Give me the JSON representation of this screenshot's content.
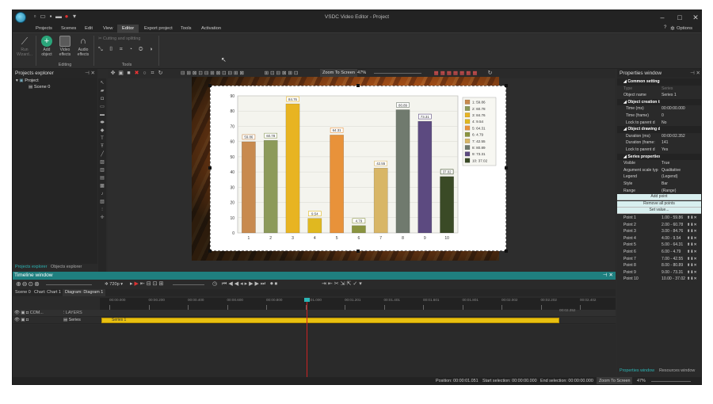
{
  "app": {
    "title": "VSDC Video Editor - Project",
    "options": "Options"
  },
  "menu": [
    "Projects",
    "Scenes",
    "Edit",
    "View",
    "Editor",
    "Export project",
    "Tools",
    "Activation"
  ],
  "ribbon": {
    "run_wizard": "Run Wizard...",
    "add_object": "Add object",
    "video_effects": "Video effects",
    "audio_effects": "Audio effects",
    "editing_group": "Editing",
    "cutting": "Cutting and splitting",
    "tools_group": "Tools"
  },
  "projects_explorer": {
    "title": "Projects explorer",
    "project": "Project",
    "scene": "Scene 0",
    "tab_projects": "Projects explorer",
    "tab_objects": "Objects explorer"
  },
  "editor_toolbar": {
    "zoom_label": "Zoom To Screen",
    "zoom_value": "47%"
  },
  "chart_data": {
    "type": "bar",
    "categories": [
      "1",
      "2",
      "3",
      "4",
      "5",
      "6",
      "7",
      "8",
      "9",
      "10"
    ],
    "values": [
      59.86,
      60.78,
      84.76,
      9.54,
      64.31,
      4.79,
      42.55,
      80.89,
      73.31,
      37.02
    ],
    "data_labels": [
      "59.86",
      "60.78",
      "84.76",
      "9.54",
      "64.31",
      "4.79",
      "42.55",
      "80.89",
      "73.31",
      "37.02"
    ],
    "legend": [
      "1: 59.86",
      "2: 60.78",
      "3: 84.76",
      "4: 9.54",
      "5: 64.31",
      "6: 4.79",
      "7: 42.55",
      "8: 80.89",
      "9: 73.31",
      "10: 37.02"
    ],
    "colors": [
      "#c88a4e",
      "#8c9a5a",
      "#e8b422",
      "#e0b820",
      "#e8923a",
      "#8a9440",
      "#d8b666",
      "#707a6e",
      "#5c4a80",
      "#3a4a26"
    ],
    "ylim": [
      0,
      90
    ],
    "yticks": [
      "0",
      "10",
      "20",
      "30",
      "40",
      "50",
      "60",
      "70",
      "80",
      "90"
    ],
    "grid": true,
    "legend_position": "right",
    "title": "",
    "xlabel": "",
    "ylabel": ""
  },
  "properties": {
    "title": "Properties window",
    "rows": [
      {
        "k": "Common settings",
        "v": "",
        "type": "sec"
      },
      {
        "k": "Type",
        "v": "Series",
        "type": "dim"
      },
      {
        "k": "Object name",
        "v": "Series 1",
        "type": "row"
      },
      {
        "k": "Object creation time",
        "v": "",
        "type": "sec"
      },
      {
        "k": "Time (ms)",
        "v": "00:00:00.000",
        "type": "sub"
      },
      {
        "k": "Time (frame)",
        "v": "0",
        "type": "sub"
      },
      {
        "k": "Lock to parent d",
        "v": "No",
        "type": "sub"
      },
      {
        "k": "Object drawing duration",
        "v": "",
        "type": "sec"
      },
      {
        "k": "Duration (ms)",
        "v": "00:00:02.352",
        "type": "sub"
      },
      {
        "k": "Duration (frame:",
        "v": "141",
        "type": "sub"
      },
      {
        "k": "Lock to parent d",
        "v": "Yes",
        "type": "sub"
      },
      {
        "k": "Series properties",
        "v": "",
        "type": "sec"
      },
      {
        "k": "Visible",
        "v": "True",
        "type": "row"
      },
      {
        "k": "Argument scale typ",
        "v": "Qualitative",
        "type": "row"
      },
      {
        "k": "Legend",
        "v": "(Legend)",
        "type": "row"
      },
      {
        "k": "Style",
        "v": "Bar",
        "type": "row"
      },
      {
        "k": "Range",
        "v": "(Range)",
        "type": "row"
      }
    ],
    "buttons": [
      "Add point",
      "Remove all points",
      "Set value..."
    ],
    "points": [
      {
        "k": "Point 1",
        "v": "1.00 - 59.86"
      },
      {
        "k": "Point 2",
        "v": "2.00 - 60.78"
      },
      {
        "k": "Point 3",
        "v": "3.00 - 84.76"
      },
      {
        "k": "Point 4",
        "v": "4.00 - 9.54"
      },
      {
        "k": "Point 5",
        "v": "5.00 - 64.31"
      },
      {
        "k": "Point 6",
        "v": "6.00 - 4.79"
      },
      {
        "k": "Point 7",
        "v": "7.00 - 42.55"
      },
      {
        "k": "Point 8",
        "v": "8.00 - 80.89"
      },
      {
        "k": "Point 9",
        "v": "9.00 - 73.31"
      },
      {
        "k": "Point 10",
        "v": "10.00 - 37.02"
      }
    ],
    "tab_properties": "Properties window",
    "tab_resources": "Resources window"
  },
  "timeline": {
    "title": "Timeline window",
    "resolution": "720p",
    "tabs": [
      "Scene 0",
      "Chart: Chart 1",
      "Diagram: Diagram 1"
    ],
    "ruler": [
      "00:00.000",
      "00:00.200",
      "00:00.400",
      "00:00.600",
      "00:00.800",
      "00:01.000",
      "00:01.201",
      "00:01.401",
      "00:01.601",
      "00:01.801",
      "00:02.002",
      "00:02.202",
      "00:02.402"
    ],
    "com_label": "COM...",
    "layers_label": "LAYERS",
    "series_label": "Series",
    "clip_label": "Series 1",
    "end_time": "00:02.352"
  },
  "status": {
    "position": "Position:  00:00:01.051",
    "start_sel": "Start selection:  00:00:00.000",
    "end_sel": "End selection:  00:00:00.000",
    "zoom": "Zoom To Screen",
    "zoom_val": "47%"
  }
}
